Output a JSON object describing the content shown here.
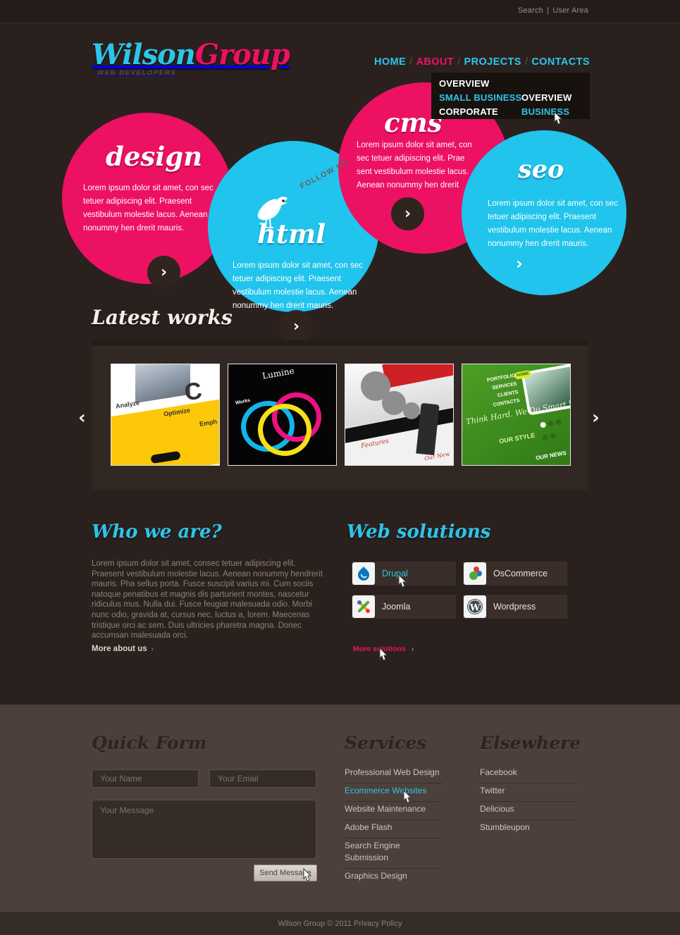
{
  "topbar": {
    "search": "Search",
    "separator": "|",
    "user_area": "User Area"
  },
  "logo": {
    "part1": "Wilson",
    "part2": "Group",
    "tagline": "WEB DEVELOPERS"
  },
  "nav": {
    "items": [
      {
        "label": "HOME",
        "active": false
      },
      {
        "label": "ABOUT",
        "active": true
      },
      {
        "label": "PROJECTS",
        "active": false
      },
      {
        "label": "CONTACTS",
        "active": false
      }
    ],
    "separator": "/"
  },
  "dropdown": {
    "column1": [
      {
        "label": "OVERVIEW",
        "highlight": false
      },
      {
        "label": "SMALL BUSINESS",
        "highlight": true
      },
      {
        "label": "CORPORATE",
        "highlight": false
      }
    ],
    "column2": [
      {
        "label": "OVERVIEW",
        "highlight": false
      },
      {
        "label": "BUSINESS",
        "highlight": true
      }
    ]
  },
  "hero": {
    "follow_us": "FOLLOW US",
    "circles": [
      {
        "title": "design",
        "text": "Lorem ipsum dolor sit amet, con sec tetuer adipiscing elit. Praesent vestibulum molestie lacus. Aenean nonummy hen drerit mauris.",
        "color": "#ec1163",
        "arrow": "›"
      },
      {
        "title": "html",
        "text": "Lorem ipsum dolor sit amet, con sec tetuer adipiscing elit. Praesent vestibulum molestie lacus. Aenean nonummy hen drerit mauris.",
        "color": "#20c4ec",
        "arrow": "›"
      },
      {
        "title": "cms",
        "text": "Lorem ipsum dolor sit amet, con sec tetuer adipiscing elit. Prae sent vestibulum molestie lacus. Aenean nonummy hen drerit",
        "color": "#ec1163",
        "arrow": "›"
      },
      {
        "title": "seo",
        "text": "Lorem ipsum dolor sit amet, con sec tetuer adipiscing elit. Praesent vestibulum molestie lacus. Aenean nonummy hen drerit mauris.",
        "color": "#20c4ec",
        "arrow": "›"
      }
    ]
  },
  "latest_works": {
    "title": "Latest works",
    "prev_arrow": "‹",
    "next_arrow": "›",
    "thumbs": [
      {
        "caption": "Analyze Optimize Emphasize yellow business site"
      },
      {
        "caption": "Lumine dark CMYK rings site"
      },
      {
        "caption": "Gears technology corporate site"
      },
      {
        "caption": "Think Hard. We Do Smart Websites green site"
      }
    ],
    "thumb2_brand": "Lumine",
    "thumb2_works": "Works",
    "thumb1_labels": [
      "Analyze",
      "Optimize",
      "Emph"
    ],
    "thumb3_labels": [
      "Features",
      "Our New"
    ],
    "thumb4_menu": [
      "PORTFOLIO",
      "SERVICES",
      "CLIENTS",
      "CONTACTS"
    ],
    "thumb4_home": "HOME",
    "thumb4_slogan": "Think Hard. We Do Smart Websites.",
    "thumb4_style": "OUR STYLE",
    "thumb4_news": "OUR NEWS"
  },
  "who_we_are": {
    "title": "Who we are?",
    "text": "Lorem ipsum dolor sit amet, consec tetuer adipiscing elit. Praesent vestibulum molestie lacus. Aenean nonummy hendrerit mauris. Pha sellus porta. Fusce suscipit varius mi. Cum sociis natoque penatibus et magnis dis parturient montes, nascetur ridiculus mus. Nulla dui. Fusce feugiat malesuada odio. Morbi nunc odio, gravida at, cursus nec, luctus a, lorem. Maecenas tristique orci ac sem. Duis ultricies pharetra magna. Donec accumsan malesuada orci.",
    "more_link": "More about us",
    "more_chevron": "›"
  },
  "web_solutions": {
    "title": "Web solutions",
    "items": [
      {
        "label": "Drupal",
        "icon": "drupal-icon",
        "hovered": true
      },
      {
        "label": "OsCommerce",
        "icon": "oscommerce-icon",
        "hovered": false
      },
      {
        "label": "Joomla",
        "icon": "joomla-icon",
        "hovered": false
      },
      {
        "label": "Wordpress",
        "icon": "wordpress-icon",
        "hovered": false
      }
    ],
    "more_link": "More solutions",
    "more_chevron": "›"
  },
  "footer": {
    "quick_form": {
      "title": "Quick Form",
      "name_placeholder": "Your Name",
      "email_placeholder": "Your Email",
      "message_placeholder": "Your Message",
      "submit_label": "Send Message"
    },
    "services": {
      "title": "Services",
      "items": [
        {
          "label": "Professional Web Design",
          "hovered": false
        },
        {
          "label": "Ecommerce Websites",
          "hovered": true
        },
        {
          "label": "Website Maintenance",
          "hovered": false
        },
        {
          "label": "Adobe Flash",
          "hovered": false
        },
        {
          "label": "Search Engine Submission",
          "hovered": false
        },
        {
          "label": "Graphics Design",
          "hovered": false
        }
      ]
    },
    "elsewhere": {
      "title": "Elsewhere",
      "items": [
        {
          "label": "Facebook"
        },
        {
          "label": "Twitter"
        },
        {
          "label": "Delicious"
        },
        {
          "label": "Stumbleupon"
        }
      ]
    },
    "copyright": "Wilson Group © 2011 Privacy Policy"
  },
  "colors": {
    "background": "#2a211e",
    "footer_background": "#4c403b",
    "accent_pink": "#ec1163",
    "accent_cyan": "#2ec4e8"
  }
}
